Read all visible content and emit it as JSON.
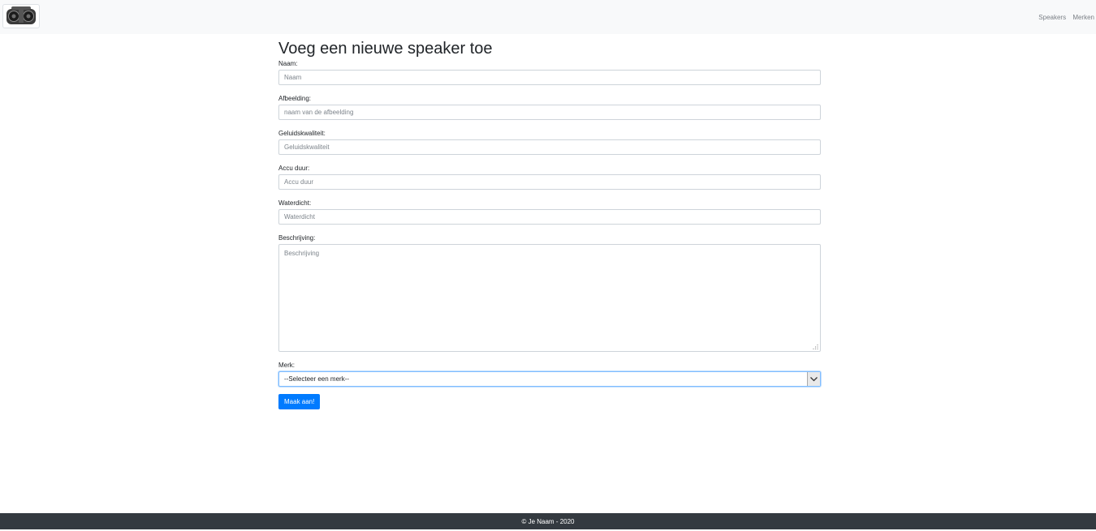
{
  "navbar": {
    "logo_icon": "speaker-logo",
    "links": [
      "Speakers",
      "Merken"
    ]
  },
  "form": {
    "title": "Voeg een nieuwe speaker toe",
    "fields": [
      {
        "label": "Naam:",
        "placeholder": "Naam",
        "value": ""
      },
      {
        "label": "Afbeelding:",
        "placeholder": "naam van de afbeelding",
        "value": ""
      },
      {
        "label": "Geluidskwaliteit:",
        "placeholder": "Geluidskwaliteit",
        "value": ""
      },
      {
        "label": "Accu duur:",
        "placeholder": "Accu duur",
        "value": ""
      },
      {
        "label": "Waterdicht:",
        "placeholder": "Waterdicht",
        "value": ""
      }
    ],
    "description": {
      "label": "Beschrijving:",
      "placeholder": "Beschrijving",
      "value": ""
    },
    "brand": {
      "label": "Merk:",
      "selected": "--Selecteer een merk--"
    },
    "submit_label": "Maak aan!"
  },
  "footer": {
    "text": "© Je Naam - 2020"
  },
  "colors": {
    "navbar_bg": "#f8f9fa",
    "primary": "#007bff",
    "footer_bg": "#343a40",
    "focus_border": "#80bdff"
  }
}
